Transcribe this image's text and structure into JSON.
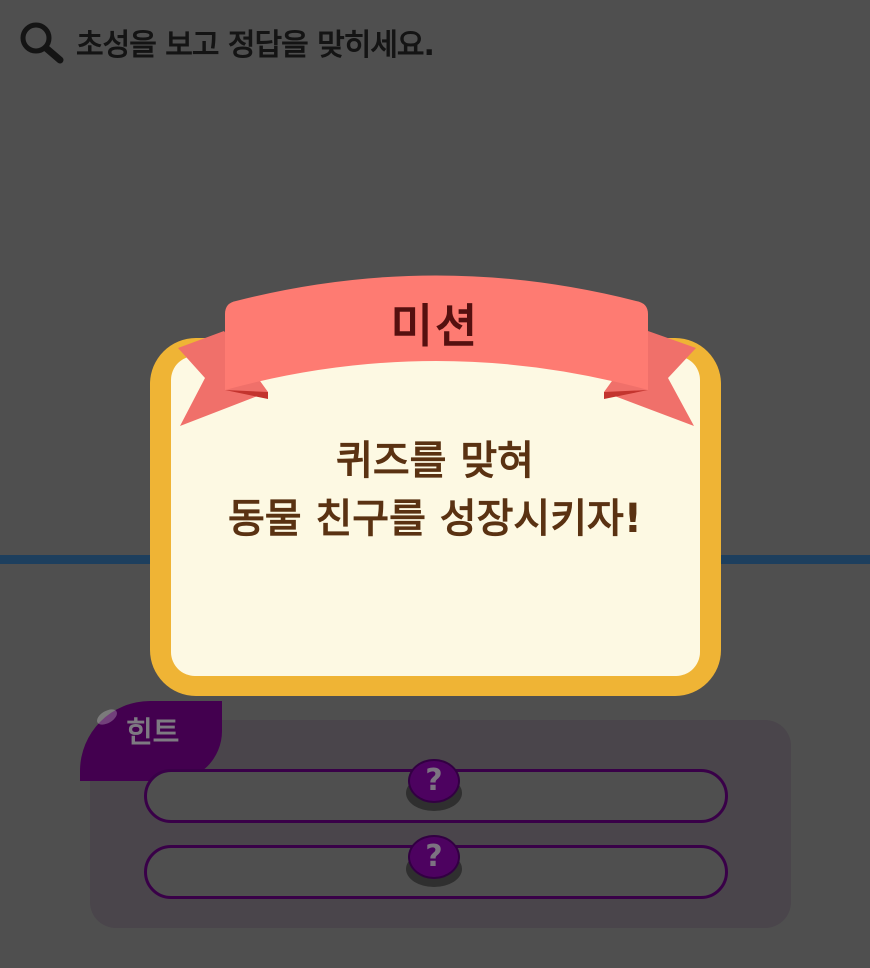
{
  "instruction": {
    "icon": "search-icon",
    "text": "초성을 보고 정답을 맞히세요."
  },
  "hint": {
    "tab_label": "힌트",
    "slots": [
      {
        "button_label": "?"
      },
      {
        "button_label": "?"
      }
    ]
  },
  "mission": {
    "title": "미션",
    "line1": "퀴즈를 맞혀",
    "line2": "동물 친구를 성장시키자!"
  },
  "colors": {
    "background": "#4f4f4f",
    "modal_frame": "#efb435",
    "modal_fill": "#fdf9e3",
    "ribbon": "#fe7b72",
    "hint_accent": "#43004f"
  }
}
